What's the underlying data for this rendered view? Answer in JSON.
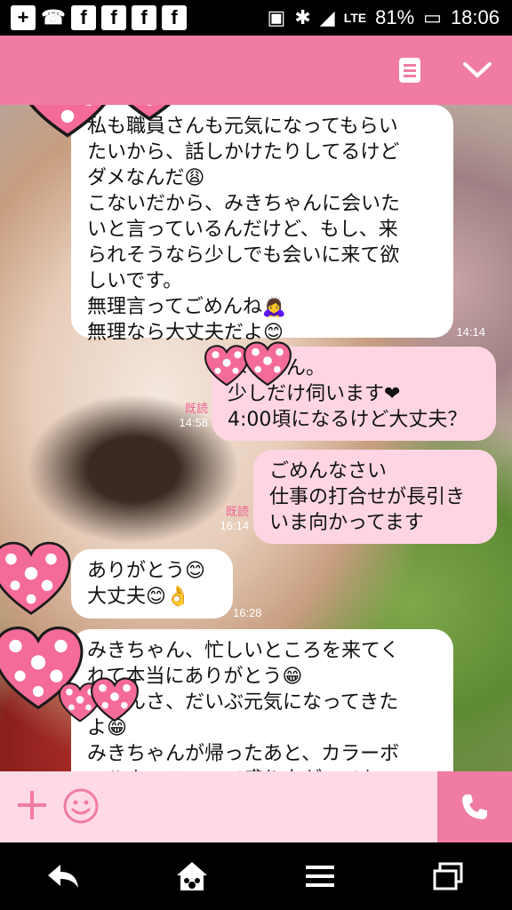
{
  "status_bar": {
    "icons_left": [
      "add-icon",
      "missed-call-icon",
      "facebook-icon",
      "facebook-icon",
      "facebook-icon",
      "facebook-icon"
    ],
    "fb_glyph": "f",
    "lte_label": "LTE",
    "battery": "81%",
    "time": "18:06"
  },
  "header": {
    "menu_icon": "notes-icon",
    "collapse_icon": "chevron-down-icon"
  },
  "messages": [
    {
      "direction": "in",
      "text": "私も職員さんも元気になってもらい\nたいから、話しかけたりしてるけど\nダメなんだ😩\nこないだから、みきちゃんに会いた\nいと言っているんだけど、もし、来\nられそうなら少しでも会いに来て欲\nしいです。\n無理言ってごめんね🙇‍♀️\n無理なら大丈夫だよ😊",
      "time": "14:14"
    },
    {
      "direction": "out",
      "text": "はいさん。\n少しだけ伺います❤\n4:00頃になるけど大丈夫？",
      "read": "既読",
      "time": "14:58"
    },
    {
      "direction": "out",
      "text": "ごめんなさい\n仕事の打合せが長引き\nいま向かってます",
      "read": "既読",
      "time": "16:14"
    },
    {
      "direction": "in",
      "text": "ありがとう😊\n大丈夫😊👌",
      "time": "16:28"
    },
    {
      "direction": "in",
      "text": "みきちゃん、忙しいところを来てく\nれて本当にありがとう😁\n　さんさ、だいぶ元気になってきた\nよ😁\nみきちゃんが帰ったあと、カラーボ\nールよいのっこで盛り上がってあ",
      "time": ""
    }
  ],
  "input_bar": {
    "plus_icon": "plus-icon",
    "sticker_icon": "smile-icon",
    "call_icon": "phone-icon"
  },
  "nav_bar": [
    "back-icon",
    "home-icon",
    "menu-icon",
    "recent-apps-icon"
  ],
  "colors": {
    "accent": "#f07ca5",
    "bubble_out": "#ffd5e4",
    "bubble_in": "#ffffff",
    "input_bg": "#ffd9e6",
    "read_label": "#f06292"
  }
}
